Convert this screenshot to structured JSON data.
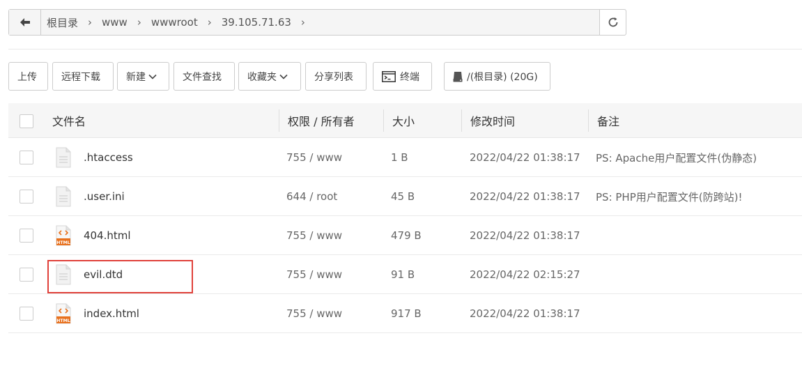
{
  "pathbar": {
    "crumbs": [
      "根目录",
      "www",
      "wwwroot",
      "39.105.71.63"
    ]
  },
  "toolbar": {
    "upload": "上传",
    "remote_download": "远程下载",
    "new": "新建",
    "file_search": "文件查找",
    "favorites": "收藏夹",
    "share_list": "分享列表",
    "terminal": "终端",
    "disk": "/(根目录) (20G)"
  },
  "table": {
    "headers": {
      "name": "文件名",
      "perm": "权限 / 所有者",
      "size": "大小",
      "mtime": "修改时间",
      "note": "备注"
    },
    "rows": [
      {
        "name": ".htaccess",
        "icon": "text-file-icon",
        "perm": "755 / www",
        "size": "1 B",
        "mtime": "2022/04/22 01:38:17",
        "note": "PS: Apache用户配置文件(伪静态)"
      },
      {
        "name": ".user.ini",
        "icon": "text-file-icon",
        "perm": "644 / root",
        "size": "45 B",
        "mtime": "2022/04/22 01:38:17",
        "note": "PS: PHP用户配置文件(防跨站)!"
      },
      {
        "name": "404.html",
        "icon": "html-file-icon",
        "perm": "755 / www",
        "size": "479 B",
        "mtime": "2022/04/22 01:38:17",
        "note": ""
      },
      {
        "name": "evil.dtd",
        "icon": "text-file-icon",
        "perm": "755 / www",
        "size": "91 B",
        "mtime": "2022/04/22 02:15:27",
        "note": ""
      },
      {
        "name": "index.html",
        "icon": "html-file-icon",
        "perm": "755 / www",
        "size": "917 B",
        "mtime": "2022/04/22 01:38:17",
        "note": ""
      }
    ]
  },
  "colors": {
    "highlight": "#e0403a",
    "html_icon": "#e8711e"
  },
  "icon_html_label": "HTML"
}
